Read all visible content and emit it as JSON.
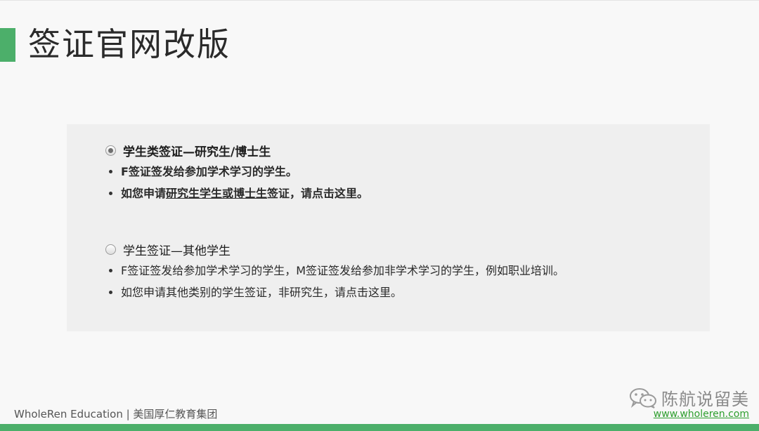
{
  "slide": {
    "title": "签证官网改版"
  },
  "options": [
    {
      "label": "学生类签证—研究生/博士生",
      "checked": true,
      "bullets": [
        {
          "text": "F签证签发给参加学术学习的学生。"
        },
        {
          "prefix": "如您申请",
          "link": "研究生学生或博士生",
          "suffix": "签证，请点击这里。"
        }
      ]
    },
    {
      "label": "学生签证—其他学生",
      "checked": false,
      "bullets": [
        {
          "text": "F签证签发给参加学术学习的学生，M签证签发给参加非学术学习的学生，例如职业培训。"
        },
        {
          "text": "如您申请其他类别的学生签证，非研究生，请点击这里。"
        }
      ]
    }
  ],
  "footer": {
    "left": "WholeRen Education | 美国厚仁教育集团",
    "brand_name": "陈航说留美",
    "brand_url": "www.wholeren.com"
  },
  "colors": {
    "accent": "#4caf6a",
    "url": "#2e9e2e"
  },
  "icons": {
    "brand": "wechat-icon"
  }
}
